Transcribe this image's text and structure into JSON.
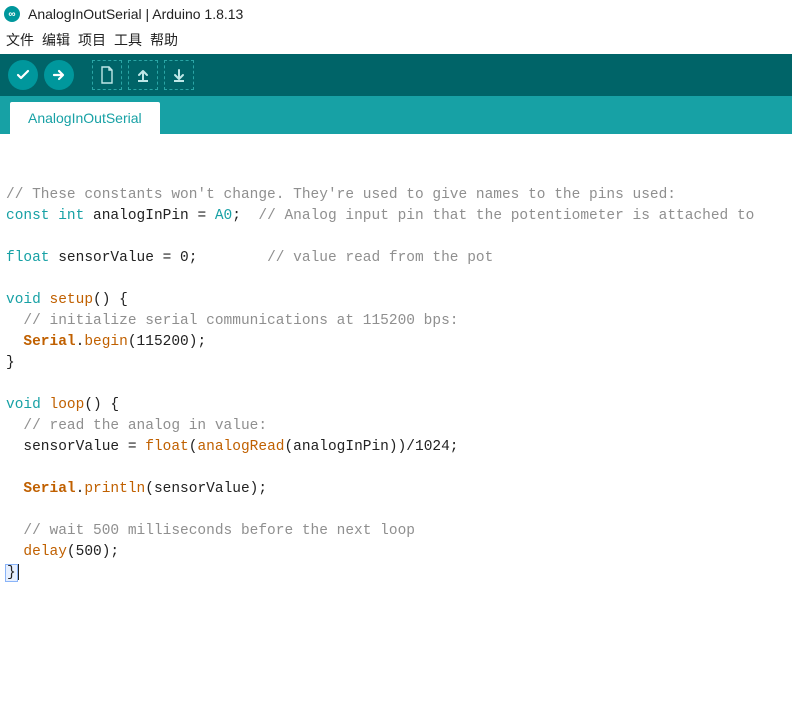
{
  "window": {
    "title": "AnalogInOutSerial | Arduino 1.8.13",
    "logo_glyph": "∞"
  },
  "menu": {
    "items": [
      "文件",
      "编辑",
      "项目",
      "工具",
      "帮助"
    ]
  },
  "toolbar": {
    "buttons": [
      "verify",
      "upload",
      "new",
      "open",
      "save"
    ]
  },
  "tabs": {
    "active": "AnalogInOutSerial"
  },
  "code": {
    "lines": [
      "",
      "// These constants won't change. They're used to give names to the pins used:",
      "const int analogInPin = A0;  // Analog input pin that the potentiometer is attached to",
      "",
      "float sensorValue = 0;        // value read from the pot",
      "",
      "void setup() {",
      "  // initialize serial communications at 115200 bps:",
      "  Serial.begin(115200);",
      "}",
      "",
      "void loop() {",
      "  // read the analog in value:",
      "  sensorValue = float(analogRead(analogInPin))/1024;",
      "",
      "  Serial.println(sensorValue);",
      "",
      "  // wait 500 milliseconds before the next loop",
      "  delay(500);",
      "}"
    ]
  }
}
